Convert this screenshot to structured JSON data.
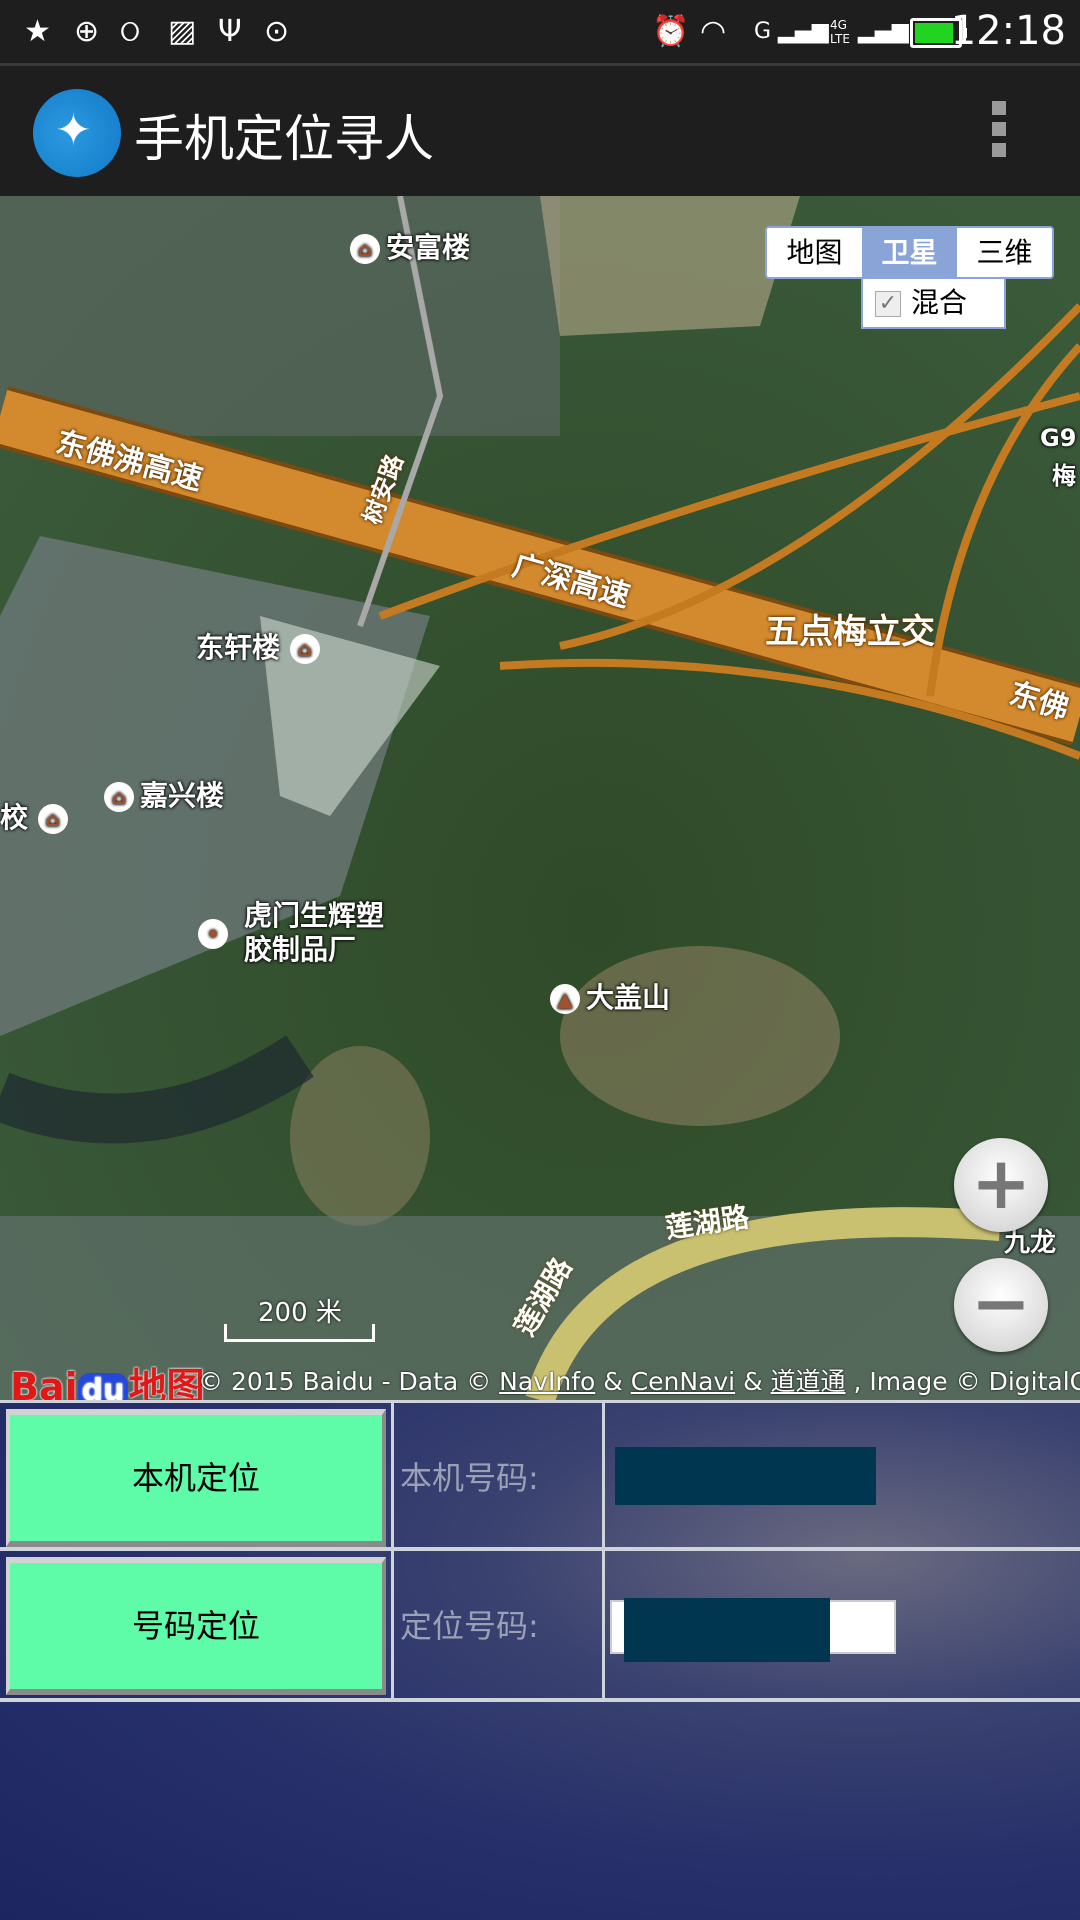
{
  "status_bar": {
    "left_icons": [
      "star-z-icon",
      "sync-icon",
      "weibo-icon",
      "image-icon",
      "usb-icon",
      "more-dots-icon"
    ],
    "right_icons": [
      "alarm-icon",
      "wifi-icon",
      "signal-g-icon",
      "signal-4g-lte-icon",
      "battery-icon"
    ],
    "network_g": "G",
    "network_4g": "4G",
    "network_lte": "LTE",
    "time": "12:18",
    "battery_level": 0.9,
    "battery_color": "#22d322"
  },
  "app_bar": {
    "title": "手机定位寻人",
    "menu_icon": "overflow-menu-icon"
  },
  "map": {
    "type_buttons": [
      "地图",
      "卫星",
      "三维"
    ],
    "active_type": "卫星",
    "hybrid_label": "混合",
    "hybrid_checked": true,
    "labels": {
      "anfu": "安富楼",
      "dongfo_highway": "东佛沸高速",
      "shuan_road": "树安路",
      "guangshen_highway": "广深高速",
      "wudianmei": "五点梅立交",
      "dongxuan": "东轩楼",
      "jiaxing": "嘉兴楼",
      "school": "校",
      "factory_line1": "虎门生辉塑",
      "factory_line2": "胶制品厂",
      "dagaishan": "大盖山",
      "lianhu_road_1": "莲湖路",
      "lianhu_road_2": "莲湖路",
      "jiulong": "九龙",
      "dongfo_right": "东佛",
      "g9": "G9",
      "mei": "梅"
    },
    "zoom_in": "+",
    "zoom_out": "−",
    "scale": "200 米",
    "logo_bai": "Bai",
    "logo_du": "du",
    "logo_map": "地图",
    "copyright_1": "© 2015 Baidu - Data © ",
    "copyright_navinfo": "NavInfo",
    "copyright_amp1": " & ",
    "copyright_cennavi": "CenNavi",
    "copyright_amp2": " & ",
    "copyright_daodaotong": "道道通",
    "copyright_2": " , Image © DigitalGlob"
  },
  "panel": {
    "locate_self_button": "本机定位",
    "self_number_label": "本机号码:",
    "locate_number_button": "号码定位",
    "target_number_label": "定位号码:",
    "button_color": "#5efba8"
  }
}
